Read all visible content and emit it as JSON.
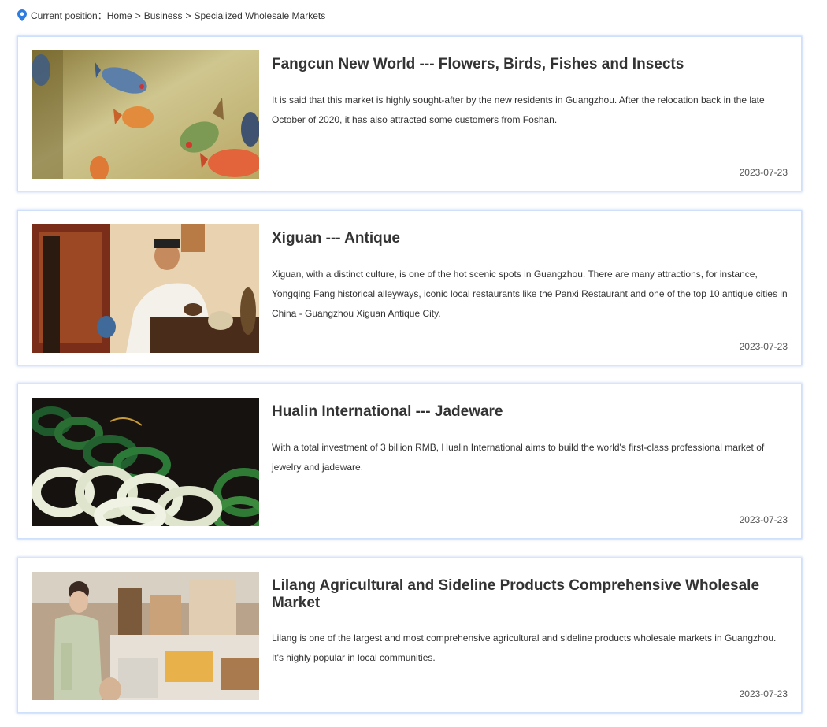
{
  "breadcrumb": {
    "icon": "location-pin-icon",
    "label": "Current position：",
    "items": [
      "Home",
      "Business",
      "Specialized Wholesale Markets"
    ],
    "separator": ">"
  },
  "accent_color": "#2e7de0",
  "articles": [
    {
      "title": "Fangcun New World --- Flowers, Birds, Fishes and Insects",
      "description": "It is said that this market is highly sought-after by the new residents in Guangzhou. After the relocation back in the late October of 2020, it has also attracted some customers from Foshan.",
      "date": "2023-07-23"
    },
    {
      "title": "Xiguan --- Antique",
      "description": "Xiguan, with a distinct culture, is one of the hot scenic spots in Guangzhou. There are many attractions, for instance, Yongqing Fang historical alleyways, iconic local restaurants like the Panxi Restaurant and one of the top 10 antique cities in China - Guangzhou Xiguan Antique City.",
      "date": "2023-07-23"
    },
    {
      "title": "Hualin International --- Jadeware",
      "description": "With a total investment of 3 billion RMB, Hualin International aims to build the world's first-class professional market of jewelry and jadeware.",
      "date": "2023-07-23"
    },
    {
      "title": "Lilang Agricultural and Sideline Products Comprehensive Wholesale Market",
      "description": "Lilang is one of the largest and most comprehensive agricultural and sideline products wholesale markets in Guangzhou. It's highly popular in local communities.",
      "date": "2023-07-23"
    }
  ]
}
